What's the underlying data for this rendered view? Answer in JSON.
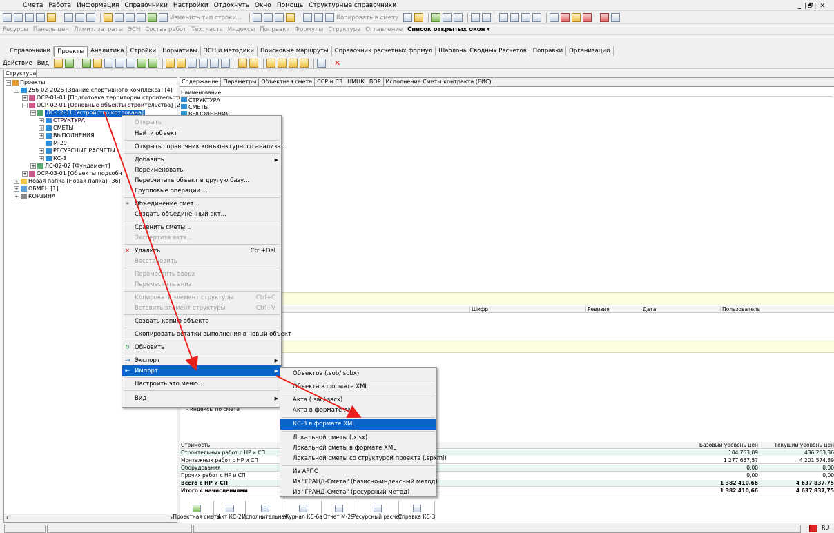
{
  "menubar": {
    "items": [
      "Смета",
      "Работа",
      "Информация",
      "Справочники",
      "Настройки",
      "Отдохнуть",
      "Окно",
      "Помощь",
      "Структурные справочники"
    ],
    "window_controls": "_ |🗗| ✕"
  },
  "toolbar1": {
    "change_row_type": "Изменить тип строки...",
    "copy_to_estimate": "Копировать в смету"
  },
  "toolbar2": {
    "items": [
      "Ресурсы",
      "Панель цен",
      "Лимит. затраты",
      "ЭСН",
      "Состав работ",
      "Тех. часть",
      "Индексы",
      "Поправки",
      "Формулы",
      "Структура",
      "Оглавление"
    ],
    "open_windows": "Список открытых окон ▾"
  },
  "tabs": [
    "Справочники",
    "Проекты",
    "Аналитика",
    "Стройки",
    "Нормативы",
    "ЭСН и методики",
    "Поисковые маршруты",
    "Справочник расчётных формул",
    "Шаблоны Сводных Расчётов",
    "Поправки",
    "Организации"
  ],
  "action_bar": {
    "action": "Действие",
    "view": "Вид"
  },
  "structure_label": "Структура",
  "tree": [
    {
      "label": "Проекты",
      "level": 0
    },
    {
      "label": "256-02-2025 [Здание спортивного комплекса]  [4]",
      "level": 1
    },
    {
      "label": "ОСР-01-01  [Подготовка территории строительства]",
      "level": 2
    },
    {
      "label": "ОСР-02-01 [Основные объекты строительства]  [2]",
      "level": 2
    },
    {
      "label": "ЛС-02-01 [Устройство котлована]",
      "level": 3
    },
    {
      "label": "СТРУКТУРА",
      "level": 4
    },
    {
      "label": "СМЕТЫ",
      "level": 4
    },
    {
      "label": "ВЫПОЛНЕНИЯ",
      "level": 4
    },
    {
      "label": "М-29",
      "level": 4
    },
    {
      "label": "РЕСУРСНЫЕ РАСЧЕТЫ",
      "level": 4
    },
    {
      "label": "КС-3",
      "level": 4
    },
    {
      "label": "ЛС-02-02 [Фундамент]",
      "level": 3
    },
    {
      "label": "ОСР-03-01 [Объекты подсобног",
      "level": 2
    },
    {
      "label": "Новая папка [Новая папка]  [36]",
      "level": 1
    },
    {
      "label": "ОБМЕН  [1]",
      "level": 1
    },
    {
      "label": "КОРЗИНА",
      "level": 1
    }
  ],
  "right_tabs": [
    "Содержание",
    "Параметры",
    "Объектная смета",
    "ССР и СЗ",
    "НМЦК",
    "ВОР",
    "Исполнение Сметы контракта (ЕИС)"
  ],
  "content": {
    "header": "Наименование",
    "rows": [
      "СТРУКТУРА",
      "СМЕТЫ",
      "ВЫПОЛНЕНИЯ"
    ]
  },
  "doc_table_headers": {
    "cipher": "Шифр",
    "revision": "Ревизия",
    "date": "Дата",
    "user": "Пользователь"
  },
  "indexes_label": "- индексы по смете",
  "cost": {
    "header": "Стоимость",
    "col_base": "Базовый уровень цен",
    "col_current": "Текущий уровень цен",
    "rows": [
      {
        "name": "Строительных работ с НР и СП",
        "base": "104 753,09",
        "current": "436 263,36"
      },
      {
        "name": "Монтажных работ с НР и СП",
        "base": "1 277 657,57",
        "current": "4 201 574,39"
      },
      {
        "name": "Оборудования",
        "base": "0,00",
        "current": "0,00"
      },
      {
        "name": "Прочих работ с НР и СП",
        "base": "0,00",
        "current": "0,00"
      },
      {
        "name": "Всего с НР и СП",
        "base": "1 382 410,66",
        "current": "4 637 837,75"
      },
      {
        "name": "Итого с начислениями",
        "base": "1 382 410,66",
        "current": "4 637 837,75"
      }
    ]
  },
  "bottom_buttons": [
    "Проектная смета",
    "Акт КС-2",
    "Исполнительная",
    "Журнал КС-6а",
    "Отчет М-29",
    "Ресурсный расчет",
    "Справка КС-3"
  ],
  "context_menu": {
    "open": "Открыть",
    "find": "Найти объект",
    "open_conjuncture": "Открыть справочник конъюнктурного анализа...",
    "add": "Добавить",
    "rename": "Переименовать",
    "recalc": "Пересчитать объект в другую базу...",
    "group_ops": "Групповые операции ...",
    "merge": "Объединение смет...",
    "create_merged": "Создать объединенный акт...",
    "compare": "Сравнить сметы...",
    "expertise": "Экспертиза акта...",
    "delete": "Удалить",
    "delete_sc": "Ctrl+Del",
    "restore": "Восстановить",
    "move_up": "Переместить вверх",
    "move_down": "Переместить вниз",
    "copy_el": "Копировать элемент структуры",
    "copy_sc": "Ctrl+C",
    "paste_el": "Вставить элемент структуры",
    "paste_sc": "Ctrl+V",
    "create_copy": "Создать копию объекта",
    "copy_rest": "Скопировать остатки выполнения в новый объект",
    "refresh": "Обновить",
    "export": "Экспорт",
    "import": "Импорт",
    "customize": "Настроить это меню...",
    "view": "Вид"
  },
  "import_submenu": [
    "Объектов (.sob/.sobx)",
    "Объекта в формате XML",
    "Акта (.sac/.sacx)",
    "Акта в формате XML",
    "КС-3 в формате XML",
    "Локальной сметы (.xlsx)",
    "Локальной сметы в формате XML",
    "Локальной сметы со структурой проекта (.spxml)",
    "Из АРПС",
    "Из \"ГРАНД-Смета\" (базисно-индексный метод)",
    "Из \"ГРАНД-Смета\" (ресурсный метод)"
  ],
  "status": {
    "lang": "RU"
  },
  "colors": {
    "highlight": "#0a63c8",
    "arrow": "#e8211d"
  }
}
